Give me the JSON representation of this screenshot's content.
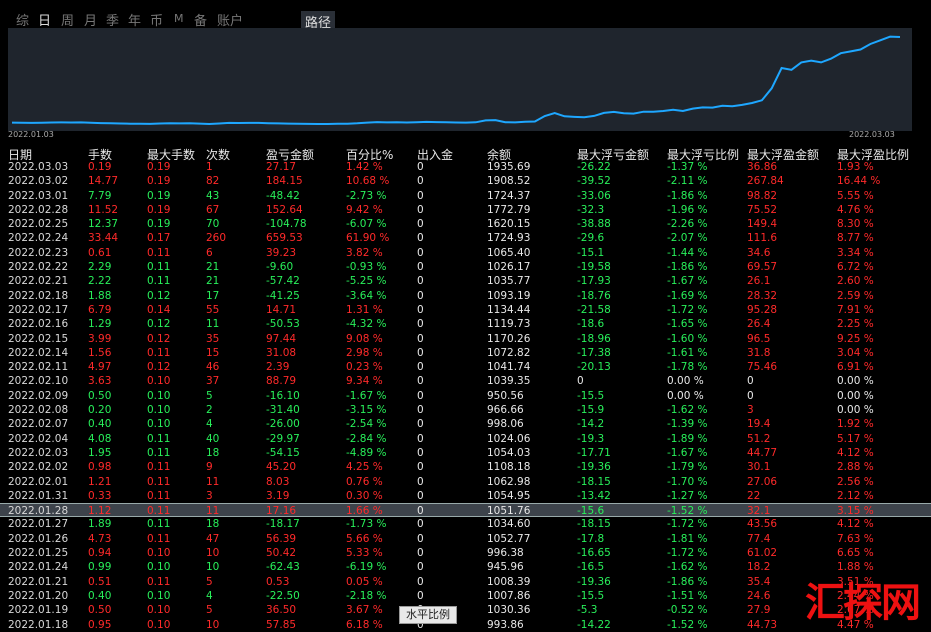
{
  "tabs": [
    {
      "label": "综",
      "active": false
    },
    {
      "label": "日",
      "active": true
    },
    {
      "label": "周",
      "active": false
    },
    {
      "label": "月",
      "active": false
    },
    {
      "label": "季",
      "active": false
    },
    {
      "label": "年",
      "active": false
    },
    {
      "label": "币",
      "active": false
    },
    {
      "label": "M",
      "active": false
    },
    {
      "label": "备",
      "active": false
    },
    {
      "label": "账户",
      "active": false
    }
  ],
  "route_button": "路径",
  "chart": {
    "start_label": "2022.01.03",
    "end_label": "2022.03.03",
    "line_color": "#1ea7ff",
    "background": "#1f252d"
  },
  "chart_data": {
    "type": "line",
    "x": [
      "2022.01.03",
      "2022.03.03"
    ],
    "series": [
      {
        "values": [
          1008,
          1006,
          1004,
          1007,
          1009,
          1010,
          1009,
          1010,
          1006,
          1002,
          1000,
          998,
          996,
          995,
          994,
          998,
          1000,
          999,
          1000,
          997,
          992,
          998,
          1004,
          1003,
          1004,
          1004,
          1001,
          999,
          997,
          996,
          994,
          993,
          993,
          995,
          996,
          1000,
          1008,
          1013,
          1010,
          1011,
          1009,
          1011,
          1015,
          1013,
          1012,
          1009,
          1008,
          1011,
          1032,
          1035,
          1012,
          1010,
          1018,
          1020,
          1079,
          1112,
          1076,
          1069,
          1065,
          1080,
          1113,
          1124,
          1110,
          1105,
          1126,
          1125,
          1133,
          1147,
          1134,
          1160,
          1172,
          1170,
          1190,
          1186,
          1200,
          1220,
          1250,
          1380,
          1600,
          1580,
          1660,
          1680,
          1660,
          1700,
          1760,
          1780,
          1800,
          1860,
          1900,
          1940,
          1936
        ]
      }
    ]
  },
  "columns": [
    "日期",
    "手数",
    "最大手数",
    "次数",
    "盈亏金额",
    "百分比%",
    "出入金",
    "余额",
    "最大浮亏金额",
    "最大浮亏比例",
    "最大浮盈金额",
    "最大浮盈比例"
  ],
  "rows": [
    {
      "date": "2022.03.03",
      "lots": "0.19",
      "max_lots": "0.19",
      "count": "1",
      "pnl": "27.17",
      "pct": "1.42 %",
      "io": "0",
      "bal": "1935.69",
      "max_loss": "-26.22",
      "loss_pct": "-1.37 %",
      "max_gain": "36.86",
      "gain_pct": "1.93 %",
      "pos": true
    },
    {
      "date": "2022.03.02",
      "lots": "14.77",
      "max_lots": "0.19",
      "count": "82",
      "pnl": "184.15",
      "pct": "10.68 %",
      "io": "0",
      "bal": "1908.52",
      "max_loss": "-39.52",
      "loss_pct": "-2.11 %",
      "max_gain": "267.84",
      "gain_pct": "16.44 %",
      "pos": true
    },
    {
      "date": "2022.03.01",
      "lots": "7.79",
      "max_lots": "0.19",
      "count": "43",
      "pnl": "-48.42",
      "pct": "-2.73 %",
      "io": "0",
      "bal": "1724.37",
      "max_loss": "-33.06",
      "loss_pct": "-1.86 %",
      "max_gain": "98.82",
      "gain_pct": "5.55 %",
      "pos": false
    },
    {
      "date": "2022.02.28",
      "lots": "11.52",
      "max_lots": "0.19",
      "count": "67",
      "pnl": "152.64",
      "pct": "9.42 %",
      "io": "0",
      "bal": "1772.79",
      "max_loss": "-32.3",
      "loss_pct": "-1.96 %",
      "max_gain": "75.52",
      "gain_pct": "4.76 %",
      "pos": true
    },
    {
      "date": "2022.02.25",
      "lots": "12.37",
      "max_lots": "0.19",
      "count": "70",
      "pnl": "-104.78",
      "pct": "-6.07 %",
      "io": "0",
      "bal": "1620.15",
      "max_loss": "-38.88",
      "loss_pct": "-2.26 %",
      "max_gain": "149.4",
      "gain_pct": "8.30 %",
      "pos": false
    },
    {
      "date": "2022.02.24",
      "lots": "33.44",
      "max_lots": "0.17",
      "count": "260",
      "pnl": "659.53",
      "pct": "61.90 %",
      "io": "0",
      "bal": "1724.93",
      "max_loss": "-29.6",
      "loss_pct": "-2.07 %",
      "max_gain": "111.6",
      "gain_pct": "8.77 %",
      "pos": true
    },
    {
      "date": "2022.02.23",
      "lots": "0.61",
      "max_lots": "0.11",
      "count": "6",
      "pnl": "39.23",
      "pct": "3.82 %",
      "io": "0",
      "bal": "1065.40",
      "max_loss": "-15.1",
      "loss_pct": "-1.44 %",
      "max_gain": "34.6",
      "gain_pct": "3.34 %",
      "pos": true
    },
    {
      "date": "2022.02.22",
      "lots": "2.29",
      "max_lots": "0.11",
      "count": "21",
      "pnl": "-9.60",
      "pct": "-0.93 %",
      "io": "0",
      "bal": "1026.17",
      "max_loss": "-19.58",
      "loss_pct": "-1.86 %",
      "max_gain": "69.57",
      "gain_pct": "6.72 %",
      "pos": false
    },
    {
      "date": "2022.02.21",
      "lots": "2.22",
      "max_lots": "0.11",
      "count": "21",
      "pnl": "-57.42",
      "pct": "-5.25 %",
      "io": "0",
      "bal": "1035.77",
      "max_loss": "-17.93",
      "loss_pct": "-1.67 %",
      "max_gain": "26.1",
      "gain_pct": "2.60 %",
      "pos": false
    },
    {
      "date": "2022.02.18",
      "lots": "1.88",
      "max_lots": "0.12",
      "count": "17",
      "pnl": "-41.25",
      "pct": "-3.64 %",
      "io": "0",
      "bal": "1093.19",
      "max_loss": "-18.76",
      "loss_pct": "-1.69 %",
      "max_gain": "28.32",
      "gain_pct": "2.59 %",
      "pos": false
    },
    {
      "date": "2022.02.17",
      "lots": "6.79",
      "max_lots": "0.14",
      "count": "55",
      "pnl": "14.71",
      "pct": "1.31 %",
      "io": "0",
      "bal": "1134.44",
      "max_loss": "-21.58",
      "loss_pct": "-1.72 %",
      "max_gain": "95.28",
      "gain_pct": "7.91 %",
      "pos": true
    },
    {
      "date": "2022.02.16",
      "lots": "1.29",
      "max_lots": "0.12",
      "count": "11",
      "pnl": "-50.53",
      "pct": "-4.32 %",
      "io": "0",
      "bal": "1119.73",
      "max_loss": "-18.6",
      "loss_pct": "-1.65 %",
      "max_gain": "26.4",
      "gain_pct": "2.25 %",
      "pos": false
    },
    {
      "date": "2022.02.15",
      "lots": "3.99",
      "max_lots": "0.12",
      "count": "35",
      "pnl": "97.44",
      "pct": "9.08 %",
      "io": "0",
      "bal": "1170.26",
      "max_loss": "-18.96",
      "loss_pct": "-1.60 %",
      "max_gain": "96.5",
      "gain_pct": "9.25 %",
      "pos": true
    },
    {
      "date": "2022.02.14",
      "lots": "1.56",
      "max_lots": "0.11",
      "count": "15",
      "pnl": "31.08",
      "pct": "2.98 %",
      "io": "0",
      "bal": "1072.82",
      "max_loss": "-17.38",
      "loss_pct": "-1.61 %",
      "max_gain": "31.8",
      "gain_pct": "3.04 %",
      "pos": true
    },
    {
      "date": "2022.02.11",
      "lots": "4.97",
      "max_lots": "0.12",
      "count": "46",
      "pnl": "2.39",
      "pct": "0.23 %",
      "io": "0",
      "bal": "1041.74",
      "max_loss": "-20.13",
      "loss_pct": "-1.78 %",
      "max_gain": "75.46",
      "gain_pct": "6.91 %",
      "pos": true
    },
    {
      "date": "2022.02.10",
      "lots": "3.63",
      "max_lots": "0.10",
      "count": "37",
      "pnl": "88.79",
      "pct": "9.34 %",
      "io": "0",
      "bal": "1039.35",
      "max_loss": "0",
      "loss_pct": "0.00 %",
      "max_gain": "0",
      "gain_pct": "0.00 %",
      "pos": true,
      "zero": true
    },
    {
      "date": "2022.02.09",
      "lots": "0.50",
      "max_lots": "0.10",
      "count": "5",
      "pnl": "-16.10",
      "pct": "-1.67 %",
      "io": "0",
      "bal": "950.56",
      "max_loss": "-15.5",
      "loss_pct": "0.00 %",
      "max_gain": "0",
      "gain_pct": "0.00 %",
      "pos": false,
      "zero": true
    },
    {
      "date": "2022.02.08",
      "lots": "0.20",
      "max_lots": "0.10",
      "count": "2",
      "pnl": "-31.40",
      "pct": "-3.15 %",
      "io": "0",
      "bal": "966.66",
      "max_loss": "-15.9",
      "loss_pct": "-1.62 %",
      "max_gain": "3",
      "gain_pct": "0.00 %",
      "pos": false,
      "zero": true
    },
    {
      "date": "2022.02.07",
      "lots": "0.40",
      "max_lots": "0.10",
      "count": "4",
      "pnl": "-26.00",
      "pct": "-2.54 %",
      "io": "0",
      "bal": "998.06",
      "max_loss": "-14.2",
      "loss_pct": "-1.39 %",
      "max_gain": "19.4",
      "gain_pct": "1.92 %",
      "pos": false
    },
    {
      "date": "2022.02.04",
      "lots": "4.08",
      "max_lots": "0.11",
      "count": "40",
      "pnl": "-29.97",
      "pct": "-2.84 %",
      "io": "0",
      "bal": "1024.06",
      "max_loss": "-19.3",
      "loss_pct": "-1.89 %",
      "max_gain": "51.2",
      "gain_pct": "5.17 %",
      "pos": false
    },
    {
      "date": "2022.02.03",
      "lots": "1.95",
      "max_lots": "0.11",
      "count": "18",
      "pnl": "-54.15",
      "pct": "-4.89 %",
      "io": "0",
      "bal": "1054.03",
      "max_loss": "-17.71",
      "loss_pct": "-1.67 %",
      "max_gain": "44.77",
      "gain_pct": "4.12 %",
      "pos": false
    },
    {
      "date": "2022.02.02",
      "lots": "0.98",
      "max_lots": "0.11",
      "count": "9",
      "pnl": "45.20",
      "pct": "4.25 %",
      "io": "0",
      "bal": "1108.18",
      "max_loss": "-19.36",
      "loss_pct": "-1.79 %",
      "max_gain": "30.1",
      "gain_pct": "2.88 %",
      "pos": true
    },
    {
      "date": "2022.02.01",
      "lots": "1.21",
      "max_lots": "0.11",
      "count": "11",
      "pnl": "8.03",
      "pct": "0.76 %",
      "io": "0",
      "bal": "1062.98",
      "max_loss": "-18.15",
      "loss_pct": "-1.70 %",
      "max_gain": "27.06",
      "gain_pct": "2.56 %",
      "pos": true
    },
    {
      "date": "2022.01.31",
      "lots": "0.33",
      "max_lots": "0.11",
      "count": "3",
      "pnl": "3.19",
      "pct": "0.30 %",
      "io": "0",
      "bal": "1054.95",
      "max_loss": "-13.42",
      "loss_pct": "-1.27 %",
      "max_gain": "22",
      "gain_pct": "2.12 %",
      "pos": true
    },
    {
      "date": "2022.01.28",
      "lots": "1.12",
      "max_lots": "0.11",
      "count": "11",
      "pnl": "17.16",
      "pct": "1.66 %",
      "io": "0",
      "bal": "1051.76",
      "max_loss": "-15.6",
      "loss_pct": "-1.52 %",
      "max_gain": "32.1",
      "gain_pct": "3.15 %",
      "pos": true,
      "sel": true
    },
    {
      "date": "2022.01.27",
      "lots": "1.89",
      "max_lots": "0.11",
      "count": "18",
      "pnl": "-18.17",
      "pct": "-1.73 %",
      "io": "0",
      "bal": "1034.60",
      "max_loss": "-18.15",
      "loss_pct": "-1.72 %",
      "max_gain": "43.56",
      "gain_pct": "4.12 %",
      "pos": false
    },
    {
      "date": "2022.01.26",
      "lots": "4.73",
      "max_lots": "0.11",
      "count": "47",
      "pnl": "56.39",
      "pct": "5.66 %",
      "io": "0",
      "bal": "1052.77",
      "max_loss": "-17.8",
      "loss_pct": "-1.81 %",
      "max_gain": "77.4",
      "gain_pct": "7.63 %",
      "pos": true
    },
    {
      "date": "2022.01.25",
      "lots": "0.94",
      "max_lots": "0.10",
      "count": "10",
      "pnl": "50.42",
      "pct": "5.33 %",
      "io": "0",
      "bal": "996.38",
      "max_loss": "-16.65",
      "loss_pct": "-1.72 %",
      "max_gain": "61.02",
      "gain_pct": "6.65 %",
      "pos": true
    },
    {
      "date": "2022.01.24",
      "lots": "0.99",
      "max_lots": "0.10",
      "count": "10",
      "pnl": "-62.43",
      "pct": "-6.19 %",
      "io": "0",
      "bal": "945.96",
      "max_loss": "-16.5",
      "loss_pct": "-1.62 %",
      "max_gain": "18.2",
      "gain_pct": "1.88 %",
      "pos": false
    },
    {
      "date": "2022.01.21",
      "lots": "0.51",
      "max_lots": "0.11",
      "count": "5",
      "pnl": "0.53",
      "pct": "0.05 %",
      "io": "0",
      "bal": "1008.39",
      "max_loss": "-19.36",
      "loss_pct": "-1.86 %",
      "max_gain": "35.4",
      "gain_pct": "3.51 %",
      "pos": true
    },
    {
      "date": "2022.01.20",
      "lots": "0.40",
      "max_lots": "0.10",
      "count": "4",
      "pnl": "-22.50",
      "pct": "-2.18 %",
      "io": "0",
      "bal": "1007.86",
      "max_loss": "-15.5",
      "loss_pct": "-1.51 %",
      "max_gain": "24.6",
      "gain_pct": "2.44 %",
      "pos": false
    },
    {
      "date": "2022.01.19",
      "lots": "0.50",
      "max_lots": "0.10",
      "count": "5",
      "pnl": "36.50",
      "pct": "3.67 %",
      "io": "0",
      "bal": "1030.36",
      "max_loss": "-5.3",
      "loss_pct": "-0.52 %",
      "max_gain": "27.9",
      "gain_pct": "2.67 %",
      "pos": true
    },
    {
      "date": "2022.01.18",
      "lots": "0.95",
      "max_lots": "0.10",
      "count": "10",
      "pnl": "57.85",
      "pct": "6.18 %",
      "io": "0",
      "bal": "993.86",
      "max_loss": "-14.22",
      "loss_pct": "-1.52 %",
      "max_gain": "44.73",
      "gain_pct": "4.47 %",
      "pos": true
    }
  ],
  "tooltip": "水平比例",
  "watermark": "汇探网"
}
